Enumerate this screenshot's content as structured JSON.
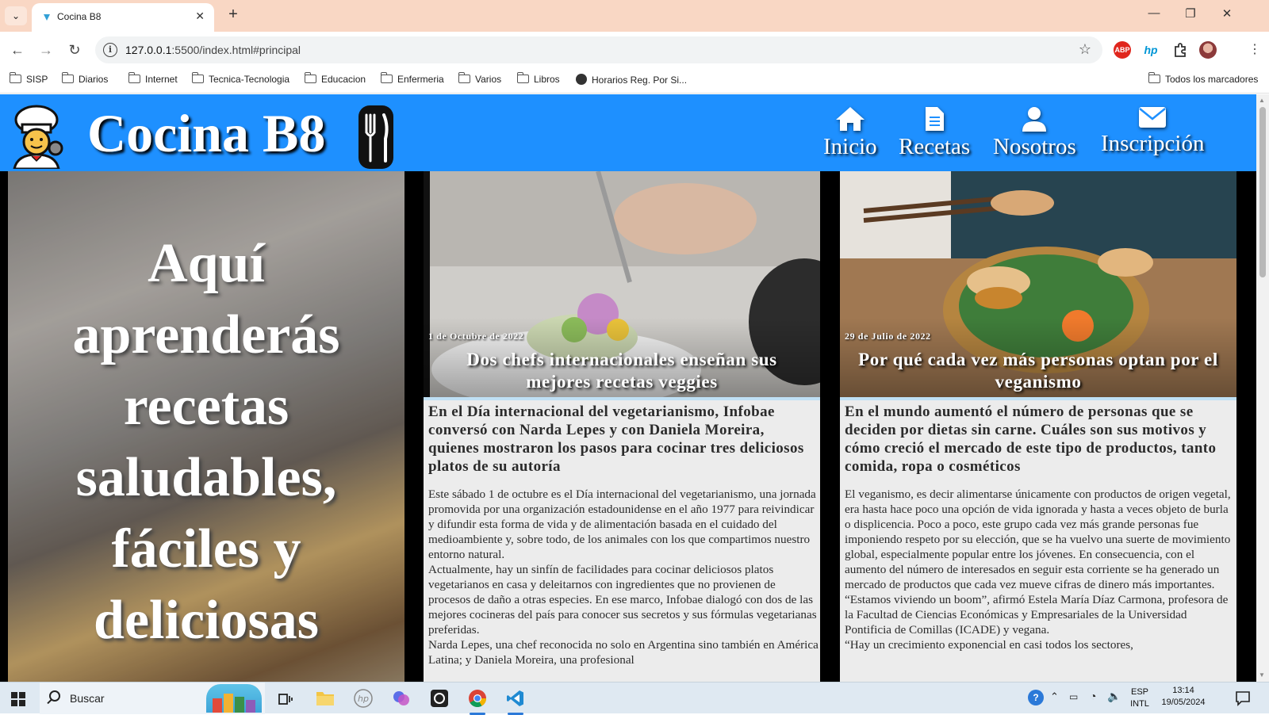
{
  "browser": {
    "tab_title": "Cocina B8",
    "tab_close": "✕",
    "new_tab": "+",
    "url_host": "127.0.0.1",
    "url_rest": ":5500/index.html#principal",
    "window_controls": {
      "minimize": "—",
      "maximize": "❐",
      "close": "✕"
    },
    "extensions": [
      {
        "name": "abp-icon",
        "label": "ABP",
        "color": "#e0261d"
      },
      {
        "name": "hp-icon",
        "label": "hp",
        "color": "#0096d6"
      }
    ],
    "bookmarks": [
      {
        "label": "SISP",
        "icon": "folder"
      },
      {
        "label": "Diarios",
        "icon": "folder"
      },
      {
        "label": "Internet",
        "icon": "folder"
      },
      {
        "label": "Tecnica-Tecnologia",
        "icon": "folder"
      },
      {
        "label": "Educacion",
        "icon": "folder"
      },
      {
        "label": "Enfermeria",
        "icon": "folder"
      },
      {
        "label": "Varios",
        "icon": "folder"
      },
      {
        "label": "Libros",
        "icon": "folder"
      },
      {
        "label": "Horarios Reg. Por Si...",
        "icon": "globe"
      }
    ],
    "all_bookmarks": "Todos los marcadores"
  },
  "site": {
    "title": "Cocina B8",
    "header_color": "#1e90ff",
    "nav": [
      {
        "label": "Inicio",
        "icon": "home"
      },
      {
        "label": "Recetas",
        "icon": "document"
      },
      {
        "label": "Nosotros",
        "icon": "user"
      },
      {
        "label": "Inscripción",
        "icon": "envelope"
      }
    ],
    "hero_text": "Aquí aprenderás recetas saludables, fáciles y deliciosas",
    "cards": [
      {
        "date": "1 de Octubre de 2022",
        "title": "Dos chefs internacionales enseñan sus mejores recetas veggies",
        "subtitle": "En el Día internacional del vegetarianismo, Infobae conversó con Narda Lepes y con Daniela Moreira, quienes mostraron los pasos para cocinar tres deliciosos platos de su autoría",
        "paragraphs": [
          "Este sábado 1 de octubre es el Día internacional del vegetarianismo, una jornada promovida por una organización estadounidense en el año 1977 para reivindicar y difundir esta forma de vida y de alimentación basada en el cuidado del medioambiente y, sobre todo, de los animales con los que compartimos nuestro entorno natural.",
          "Actualmente, hay un sinfín de facilidades para cocinar deliciosos platos vegetarianos en casa y deleitarnos con ingredientes que no provienen de procesos de daño a otras especies. En ese marco, Infobae dialogó con dos de las mejores cocineras del país para conocer sus secretos y sus fórmulas vegetarianas preferidas.",
          "Narda Lepes, una chef reconocida no solo en Argentina sino también en América Latina; y Daniela Moreira, una profesional"
        ]
      },
      {
        "date": "29 de Julio de 2022",
        "title": "Por qué cada vez más personas optan por el veganismo",
        "subtitle": "En el mundo aumentó el número de personas que se deciden por dietas sin carne. Cuáles son sus motivos y cómo creció el mercado de este tipo de productos, tanto comida, ropa o cosméticos",
        "paragraphs": [
          "El veganismo, es decir alimentarse únicamente con productos de origen vegetal, era hasta hace poco una opción de vida ignorada y hasta a veces objeto de burla o displicencia. Poco a poco, este grupo cada vez más grande personas fue imponiendo respeto por su elección, que se ha vuelvo una suerte de movimiento global, especialmente popular entre los jóvenes. En consecuencia, con el aumento del número de interesados en seguir esta corriente se ha generado un mercado de productos que cada vez mueve cifras de dinero más importantes.",
          "“Estamos viviendo un boom”, afirmó Estela María Díaz Carmona, profesora de la Facultad de Ciencias Económicas y Empresariales de la Universidad Pontificia de Comillas (ICADE) y vegana.",
          "“Hay un crecimiento exponencial en casi todos los sectores,"
        ]
      }
    ]
  },
  "taskbar": {
    "search_placeholder": "Buscar",
    "lang_top": "ESP",
    "lang_bottom": "INTL",
    "time": "13:14",
    "date": "19/05/2024"
  }
}
